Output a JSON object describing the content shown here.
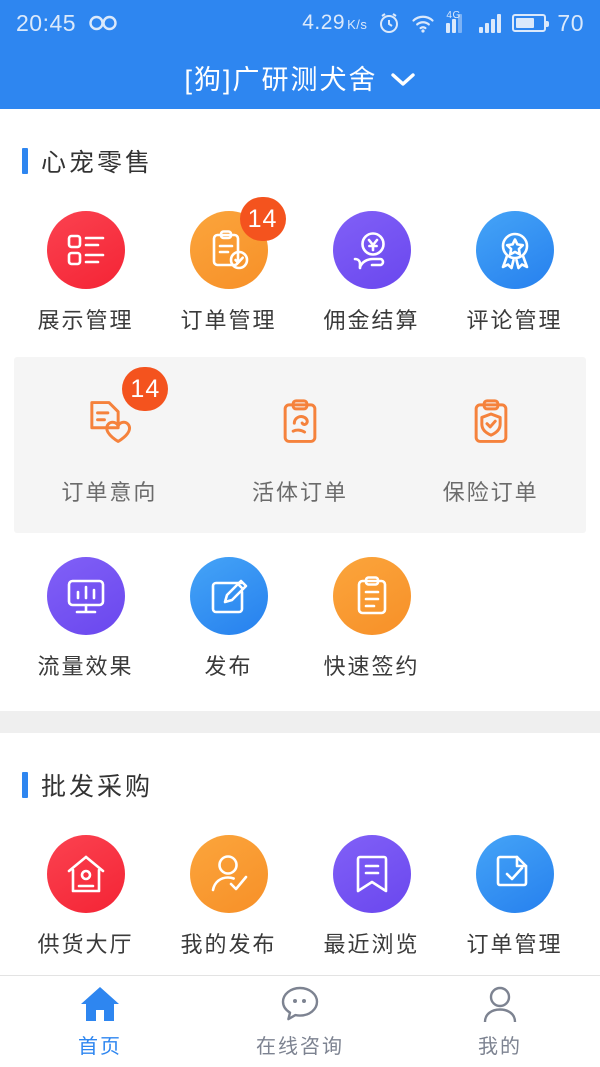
{
  "status_bar": {
    "time": "20:45",
    "infinity_icon": "infinity-icon",
    "net_speed_value": "4.29",
    "net_speed_unit": "K/s",
    "alarm_icon": "alarm-icon",
    "wifi_icon": "wifi-icon",
    "signal_4g_label": "4G",
    "signal_icon": "signal-bars-icon",
    "signal_icon_2": "signal-bars-icon",
    "battery_icon": "battery-icon",
    "battery_level": "70"
  },
  "header": {
    "title": "[狗]广研测犬舍",
    "dropdown_icon": "chevron-down-icon",
    "bg_color": "#2E86F0"
  },
  "sections": [
    {
      "title": "心宠零售",
      "accent_color": "#2E86F0",
      "rows": [
        {
          "style": "filled",
          "items": [
            {
              "label": "展示管理",
              "icon": "list-icon",
              "color": "#F42435",
              "badge": null
            },
            {
              "label": "订单管理",
              "icon": "clipboard-check-icon",
              "color": "#F79028",
              "badge": "14"
            },
            {
              "label": "佣金结算",
              "icon": "hand-yuan-coin-icon",
              "color": "#6A47EE",
              "badge": null
            },
            {
              "label": "评论管理",
              "icon": "medal-star-icon",
              "color": "#2680EE",
              "badge": null
            }
          ]
        },
        {
          "style": "panel",
          "items": [
            {
              "label": "订单意向",
              "icon": "document-heart-icon",
              "color": "#F5823C",
              "badge": "14"
            },
            {
              "label": "活体订单",
              "icon": "clipboard-pet-icon",
              "color": "#F5823C",
              "badge": null
            },
            {
              "label": "保险订单",
              "icon": "clipboard-shield-check-icon",
              "color": "#F5823C",
              "badge": null
            }
          ]
        },
        {
          "style": "filled",
          "items": [
            {
              "label": "流量效果",
              "icon": "monitor-chart-icon",
              "color": "#6A47EE",
              "badge": null
            },
            {
              "label": "发布",
              "icon": "edit-pencil-icon",
              "color": "#2680EE",
              "badge": null
            },
            {
              "label": "快速签约",
              "icon": "clipboard-lines-icon",
              "color": "#F79028",
              "badge": null
            }
          ]
        }
      ]
    },
    {
      "title": "批发采购",
      "accent_color": "#2E86F0",
      "rows": [
        {
          "style": "filled",
          "items": [
            {
              "label": "供货大厅",
              "icon": "house-icon",
              "color": "#F42435",
              "badge": null
            },
            {
              "label": "我的发布",
              "icon": "person-check-icon",
              "color": "#F79028",
              "badge": null
            },
            {
              "label": "最近浏览",
              "icon": "bookmark-icon",
              "color": "#6A47EE",
              "badge": null
            },
            {
              "label": "订单管理",
              "icon": "document-check-icon",
              "color": "#2680EE",
              "badge": null
            }
          ]
        }
      ]
    }
  ],
  "bottom_nav": {
    "active_color": "#2E86F0",
    "inactive_color": "#7d8391",
    "items": [
      {
        "label": "首页",
        "icon": "home-icon",
        "active": true
      },
      {
        "label": "在线咨询",
        "icon": "chat-bubble-icon",
        "active": false
      },
      {
        "label": "我的",
        "icon": "person-icon",
        "active": false
      }
    ]
  }
}
